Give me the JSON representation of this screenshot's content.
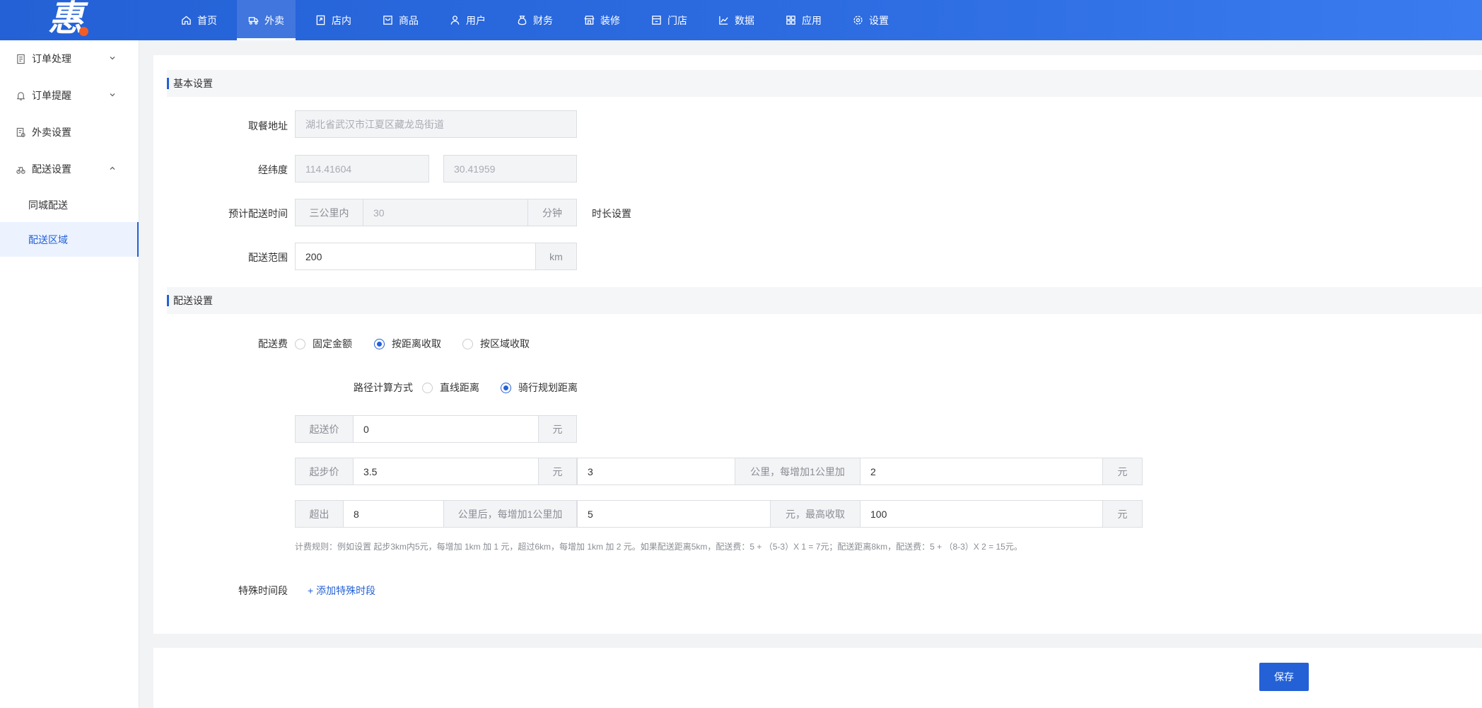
{
  "brand": {
    "logo_char": "惠",
    "accent": "#2461d6",
    "logo_dot_color": "#f25c27"
  },
  "topnav": [
    {
      "label": "首页",
      "icon": "home-icon"
    },
    {
      "label": "外卖",
      "icon": "takeout-icon",
      "active": true
    },
    {
      "label": "店内",
      "icon": "dine-in-icon"
    },
    {
      "label": "商品",
      "icon": "goods-icon"
    },
    {
      "label": "用户",
      "icon": "user-icon"
    },
    {
      "label": "财务",
      "icon": "finance-icon"
    },
    {
      "label": "装修",
      "icon": "decor-icon"
    },
    {
      "label": "门店",
      "icon": "store-icon"
    },
    {
      "label": "数据",
      "icon": "chart-icon"
    },
    {
      "label": "应用",
      "icon": "apps-icon"
    },
    {
      "label": "设置",
      "icon": "gear-icon"
    }
  ],
  "sidebar": {
    "groups": [
      {
        "label": "订单处理",
        "icon": "order-icon",
        "expanded": false
      },
      {
        "label": "订单提醒",
        "icon": "bell-icon",
        "expanded": false
      },
      {
        "label": "外卖设置",
        "icon": "takeout-settings-icon"
      },
      {
        "label": "配送设置",
        "icon": "delivery-icon",
        "expanded": true
      }
    ],
    "sub_items": [
      {
        "label": "同城配送"
      },
      {
        "label": "配送区域",
        "active": true
      }
    ]
  },
  "basic": {
    "title": "基本设置",
    "pickup_label": "取餐地址",
    "pickup_value": "湖北省武汉市江夏区藏龙岛街道",
    "coords_label": "经纬度",
    "lng": "114.41604",
    "lat": "30.41959",
    "eta_label": "预计配送时间",
    "eta_prefix": "三公里内",
    "eta_value": "30",
    "eta_unit": "分钟",
    "eta_link": "时长设置",
    "range_label": "配送范围",
    "range_value": "200",
    "range_unit": "km"
  },
  "delivery": {
    "title": "配送设置",
    "fee_label": "配送费",
    "fee_options": [
      "固定金额",
      "按距离收取",
      "按区域收取"
    ],
    "fee_selected": 1,
    "route_label": "路径计算方式",
    "route_options": [
      "直线距离",
      "骑行规划距离"
    ],
    "route_selected": 1,
    "min_order_label": "起送价",
    "min_order_value": "0",
    "yuan": "元",
    "start_price_label": "起步价",
    "start_price_value": "3.5",
    "start_km_value": "3",
    "per_km_label": "公里，每增加1公里加",
    "per_km_value": "2",
    "exceed_label": "超出",
    "exceed_value": "8",
    "after_km_label": "公里后，每增加1公里加",
    "after_km_value": "5",
    "max_label": "元，最高收取",
    "max_value": "100",
    "rule_note": "计费规则：例如设置 起步3km内5元，每增加 1km 加 1 元，超过6km，每增加 1km 加 2 元。如果配送距离5km，配送费：5 + （5-3）X 1 = 7元；配送距离8km，配送费：5 + （8-3）X 2 = 15元。",
    "special_label": "特殊时间段",
    "add_special": "+ 添加特殊时段"
  },
  "footer": {
    "save_label": "保存"
  }
}
